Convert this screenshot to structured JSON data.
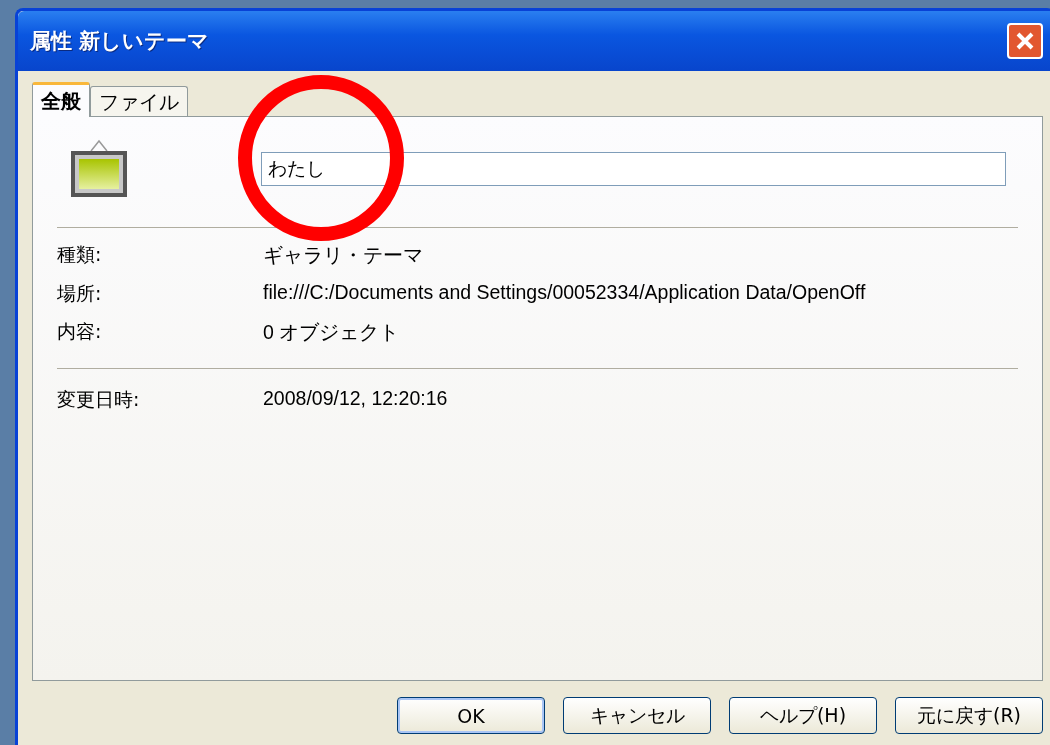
{
  "window": {
    "title": "属性 新しいテーマ"
  },
  "tabs": [
    {
      "label": "全般",
      "selected": true
    },
    {
      "label": "ファイル",
      "selected": false
    }
  ],
  "name_field": {
    "value": "わたし"
  },
  "info_rows": [
    {
      "label": "種類:",
      "value": "ギャラリ・テーマ"
    },
    {
      "label": "場所:",
      "value": "file:///C:/Documents and Settings/00052334/Application Data/OpenOff"
    },
    {
      "label": "内容:",
      "value": "0 オブジェクト"
    }
  ],
  "modified": {
    "label": "変更日時:",
    "value": "2008/09/12, 12:20:16"
  },
  "buttons": [
    {
      "label": "OK",
      "default": true
    },
    {
      "label": "キャンセル",
      "default": false
    },
    {
      "label": "ヘルプ(H)",
      "default": false
    },
    {
      "label": "元に戻す(R)",
      "default": false
    }
  ],
  "annotation": {
    "kind": "circle"
  }
}
